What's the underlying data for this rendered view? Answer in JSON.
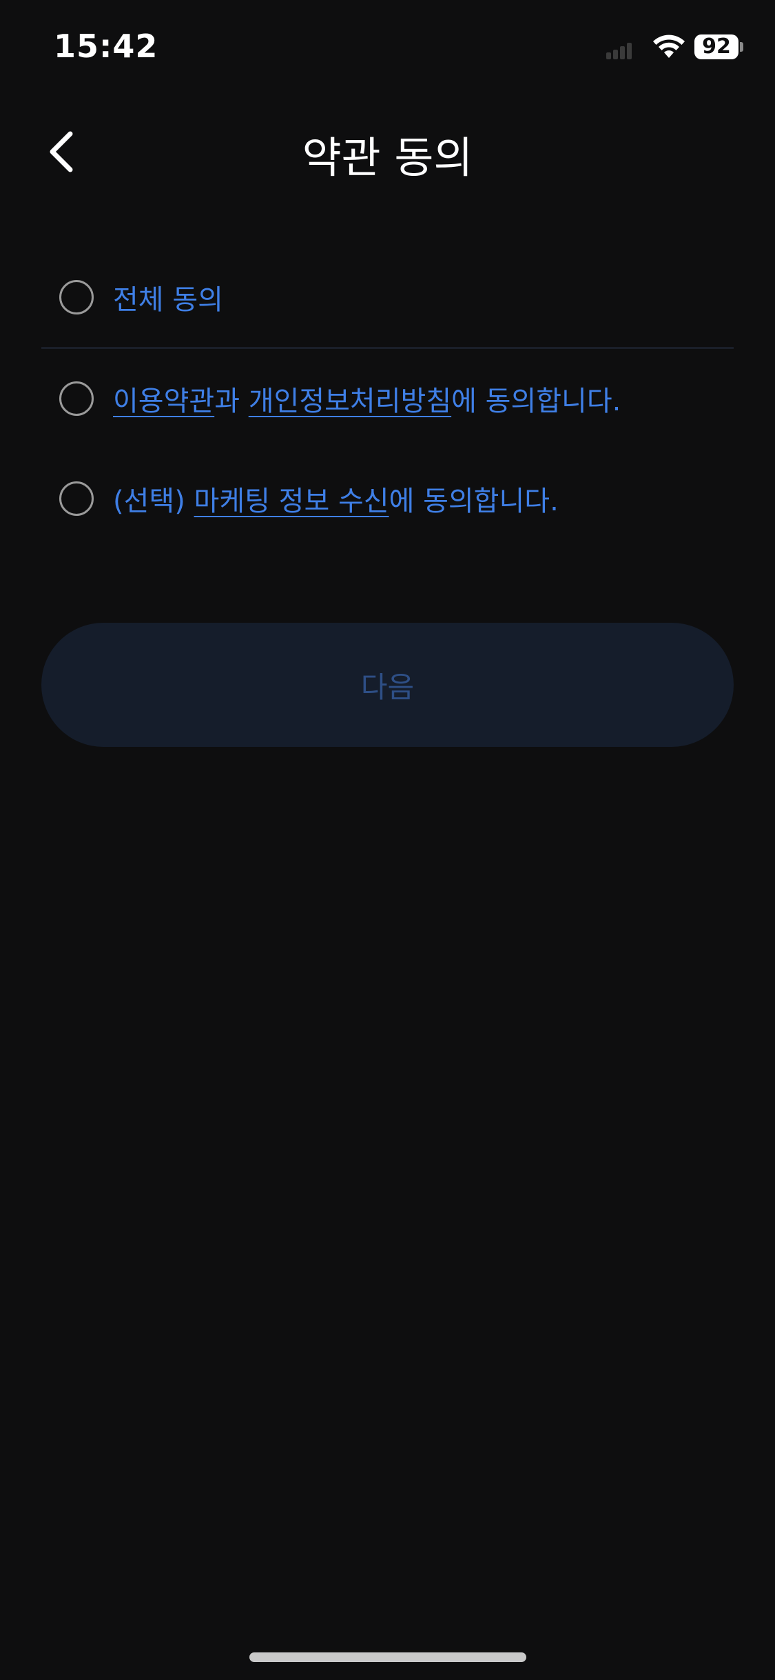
{
  "status_bar": {
    "time": "15:42",
    "battery_level": "92"
  },
  "header": {
    "title": "약관 동의",
    "back_icon": "chevron-left-icon"
  },
  "agreements": {
    "all": {
      "label": "전체 동의",
      "checked": false
    },
    "terms": {
      "link1": "이용약관",
      "connector": "과 ",
      "link2": "개인정보처리방침",
      "suffix": "에 동의합니다.",
      "checked": false
    },
    "marketing": {
      "prefix": "(선택) ",
      "link": "마케팅 정보 수신",
      "suffix": "에 동의합니다.",
      "checked": false
    }
  },
  "next_button": {
    "label": "다음",
    "enabled": false
  },
  "colors": {
    "background": "#0e0e0f",
    "accent": "#3f7fe6",
    "button_disabled_bg": "#151d2b",
    "button_disabled_text": "#2e4f86"
  }
}
